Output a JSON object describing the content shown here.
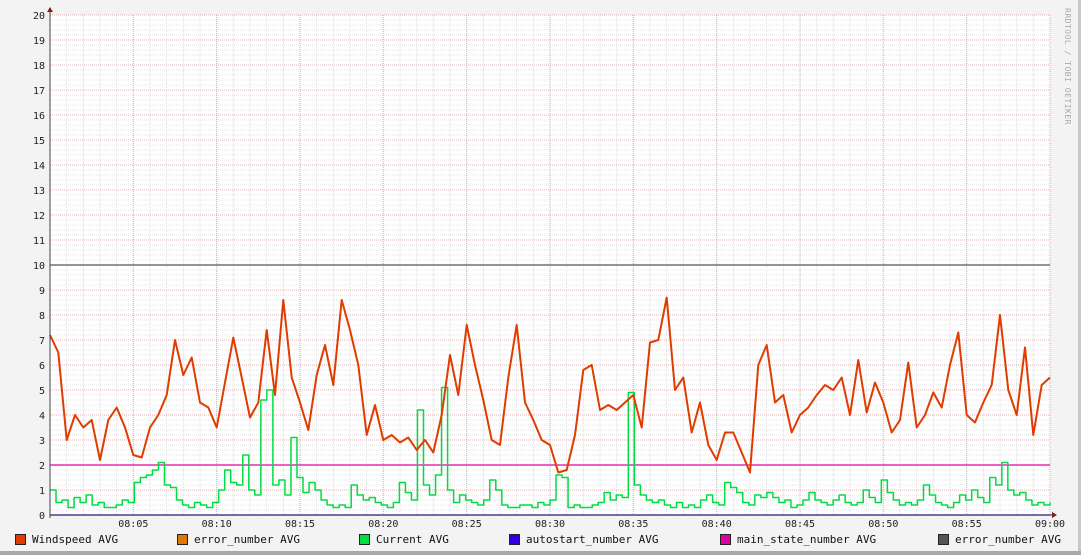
{
  "watermark": "RRDTOOL / TOBI OETIKER",
  "colors": {
    "windspeed": "#e03c00",
    "error_number": "#e07800",
    "current": "#00dd44",
    "autostart": "#3000e0",
    "main_state": "#e000a0",
    "error_number_2": "#555555"
  },
  "chart_data": {
    "type": "line",
    "title": "",
    "xlabel": "",
    "ylabel": "",
    "ylim": [
      0,
      20
    ],
    "yticks": [
      "0",
      "1",
      "2",
      "3",
      "4",
      "5",
      "6",
      "7",
      "8",
      "9",
      "10",
      "11",
      "12",
      "13",
      "14",
      "15",
      "16",
      "17",
      "18",
      "19",
      "20"
    ],
    "xlim_minutes": [
      0,
      60
    ],
    "xticks": [
      {
        "label": "08:05",
        "minute": 5
      },
      {
        "label": "08:10",
        "minute": 10
      },
      {
        "label": "08:15",
        "minute": 15
      },
      {
        "label": "08:20",
        "minute": 20
      },
      {
        "label": "08:25",
        "minute": 25
      },
      {
        "label": "08:30",
        "minute": 30
      },
      {
        "label": "08:35",
        "minute": 35
      },
      {
        "label": "08:40",
        "minute": 40
      },
      {
        "label": "08:45",
        "minute": 45
      },
      {
        "label": "08:50",
        "minute": 50
      },
      {
        "label": "08:55",
        "minute": 55
      },
      {
        "label": "09:00",
        "minute": 60
      }
    ],
    "x_step_minutes": 0.5,
    "grid": true,
    "legend_position": "bottom",
    "series": [
      {
        "name": "Windspeed AVG",
        "color": "#e03c00",
        "values": [
          7.2,
          6.5,
          3.0,
          4.0,
          3.5,
          3.8,
          2.2,
          3.8,
          4.3,
          3.5,
          2.4,
          2.3,
          3.5,
          4.0,
          4.8,
          7.0,
          5.6,
          6.3,
          4.5,
          4.3,
          3.5,
          5.3,
          7.1,
          5.5,
          3.9,
          4.5,
          7.4,
          4.8,
          8.6,
          5.5,
          4.5,
          3.4,
          5.6,
          6.8,
          5.2,
          8.6,
          7.4,
          6.0,
          3.2,
          4.4,
          3.0,
          3.2,
          2.9,
          3.1,
          2.6,
          3.0,
          2.5,
          4.0,
          6.4,
          4.8,
          7.6,
          6.0,
          4.6,
          3.0,
          2.8,
          5.5,
          7.6,
          4.5,
          3.8,
          3.0,
          2.8,
          1.7,
          1.8,
          3.2,
          5.8,
          6.0,
          4.2,
          4.4,
          4.2,
          4.5,
          4.8,
          3.5,
          6.9,
          7.0,
          8.7,
          5.0,
          5.5,
          3.3,
          4.5,
          2.8,
          2.2,
          3.3,
          3.3,
          2.5,
          1.7,
          6.0,
          6.8,
          4.5,
          4.8,
          3.3,
          4.0,
          4.3,
          4.8,
          5.2,
          5.0,
          5.5,
          4.0,
          6.2,
          4.1,
          5.3,
          4.5,
          3.3,
          3.8,
          6.1,
          3.5,
          4.0,
          4.9,
          4.3,
          6.0,
          7.3,
          4.0,
          3.7,
          4.5,
          5.2,
          8.0,
          5.0,
          4.0,
          6.7,
          3.2,
          5.2,
          5.5
        ]
      },
      {
        "name": "error_number AVG",
        "color": "#e07800",
        "values": []
      },
      {
        "name": "Current AVG",
        "color": "#00dd44",
        "values": [
          1.0,
          0.5,
          0.6,
          0.3,
          0.7,
          0.5,
          0.8,
          0.4,
          0.5,
          0.3,
          0.3,
          0.4,
          0.6,
          0.5,
          1.3,
          1.5,
          1.6,
          1.8,
          2.1,
          1.2,
          1.1,
          0.6,
          0.4,
          0.3,
          0.5,
          0.4,
          0.3,
          0.5,
          1.0,
          1.8,
          1.3,
          1.2,
          2.4,
          1.0,
          0.8,
          4.6,
          5.0,
          1.2,
          1.4,
          0.8,
          3.1,
          1.5,
          0.9,
          1.3,
          1.0,
          0.6,
          0.4,
          0.3,
          0.4,
          0.3,
          1.2,
          0.8,
          0.6,
          0.7,
          0.5,
          0.4,
          0.3,
          0.5,
          1.3,
          0.9,
          0.6,
          4.2,
          1.2,
          0.8,
          1.6,
          5.1,
          1.0,
          0.5,
          0.8,
          0.6,
          0.5,
          0.4,
          0.6,
          1.4,
          1.0,
          0.4,
          0.3,
          0.3,
          0.4,
          0.4,
          0.3,
          0.5,
          0.4,
          0.6,
          1.6,
          1.5,
          0.3,
          0.4,
          0.3,
          0.3,
          0.4,
          0.5,
          0.9,
          0.6,
          0.8,
          0.7,
          4.9,
          1.2,
          0.8,
          0.6,
          0.5,
          0.6,
          0.4,
          0.3,
          0.5,
          0.3,
          0.4,
          0.3,
          0.6,
          0.8,
          0.5,
          0.4,
          1.3,
          1.1,
          0.9,
          0.5,
          0.4,
          0.8,
          0.7,
          0.9,
          0.7,
          0.5,
          0.6,
          0.3,
          0.4,
          0.6,
          0.9,
          0.6,
          0.5,
          0.4,
          0.6,
          0.8,
          0.5,
          0.4,
          0.5,
          1.0,
          0.7,
          0.5,
          1.4,
          0.9,
          0.6,
          0.4,
          0.5,
          0.4,
          0.6,
          1.2,
          0.8,
          0.5,
          0.4,
          0.3,
          0.5,
          0.8,
          0.6,
          1.0,
          0.7,
          0.5,
          1.5,
          1.2,
          2.1,
          1.0,
          0.8,
          0.9,
          0.6,
          0.4,
          0.5,
          0.4,
          0.5
        ]
      },
      {
        "name": "autostart_number AVG",
        "color": "#3000e0",
        "values": [
          0
        ]
      },
      {
        "name": "main_state_number AVG",
        "color": "#e000a0",
        "values": [
          2
        ]
      },
      {
        "name": "error_number AVG",
        "color": "#555555",
        "values": [
          10
        ]
      }
    ]
  }
}
